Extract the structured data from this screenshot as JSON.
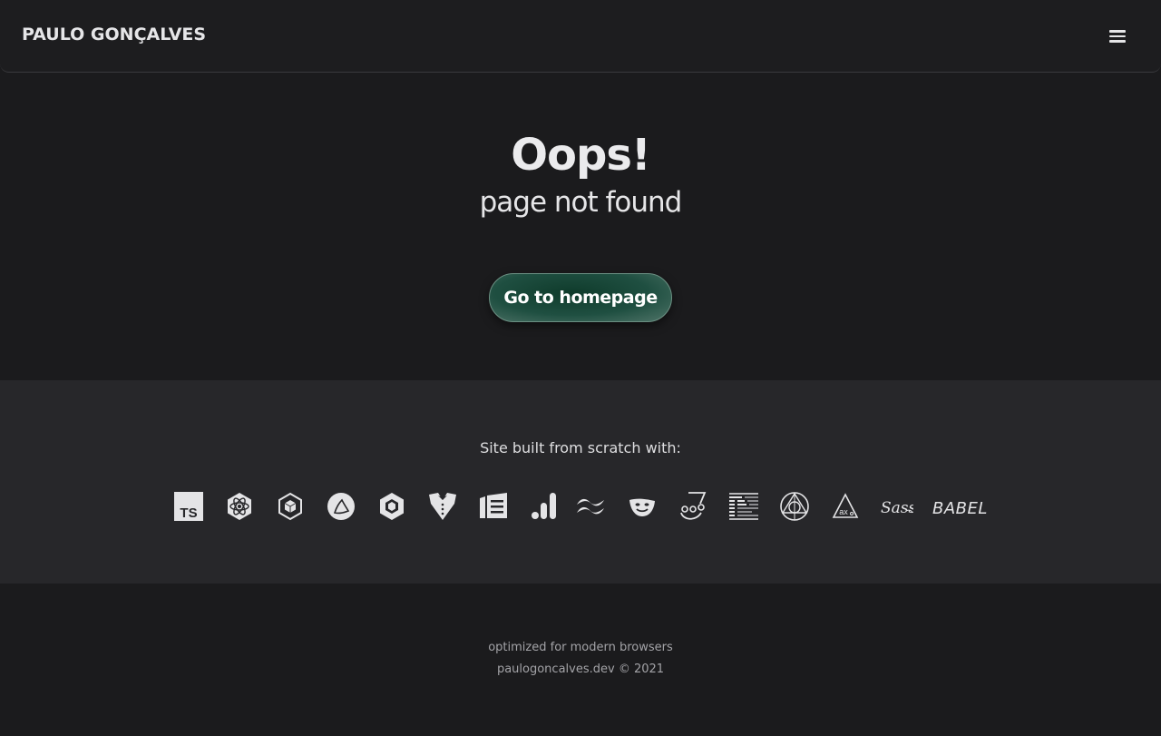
{
  "header": {
    "brand": "PAULO GONÇALVES",
    "menu_icon": "hamburger-menu-icon"
  },
  "hero": {
    "title": "Oops!",
    "subtitle": "page not found",
    "button_label": "Go to homepage"
  },
  "built": {
    "label": "Site built from scratch with:",
    "technologies": [
      {
        "icon": "typescript-icon",
        "label": "TS"
      },
      {
        "icon": "react-icon"
      },
      {
        "icon": "webpack-icon"
      },
      {
        "icon": "gatsby-icon"
      },
      {
        "icon": "eslint-icon"
      },
      {
        "icon": "tuxedo-icon"
      },
      {
        "icon": "storybook-icon"
      },
      {
        "icon": "analytics-icon"
      },
      {
        "icon": "tailwind-icon"
      },
      {
        "icon": "playwright-icon"
      },
      {
        "icon": "jest-icon"
      },
      {
        "icon": "prettier-icon"
      },
      {
        "icon": "photon-icon"
      },
      {
        "icon": "axe-icon",
        "label": "ax"
      },
      {
        "icon": "sass-icon",
        "label": "Sass"
      },
      {
        "icon": "babel-icon",
        "label": "BABEL"
      }
    ]
  },
  "footer": {
    "line1": "optimized for modern browsers",
    "line2": "paulogoncalves.dev © 2021"
  },
  "colors": {
    "background": "#1b1b1d",
    "band": "#27272a",
    "button": "#1f4f41"
  }
}
